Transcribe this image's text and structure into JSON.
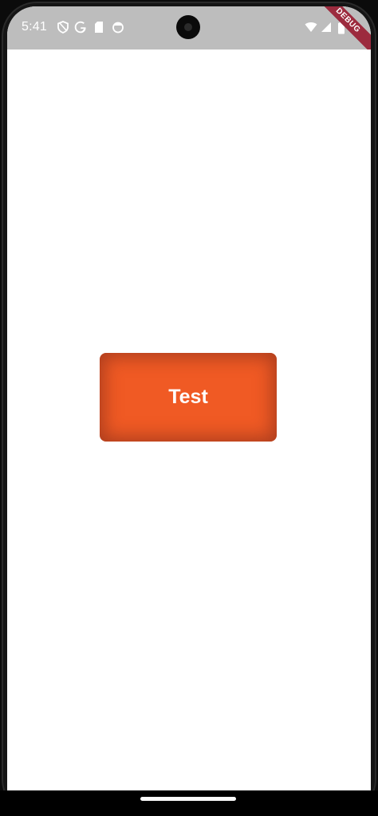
{
  "status_bar": {
    "time": "5:41",
    "left_icons": [
      "shield-icon",
      "google-icon",
      "sim-card-icon",
      "face-icon"
    ],
    "right_icons": [
      "wifi-icon",
      "signal-icon",
      "battery-icon"
    ],
    "background": "#bdbdbd"
  },
  "debug_banner": {
    "label": "DEBUG",
    "color": "#9c2b3e"
  },
  "main": {
    "button_label": "Test",
    "button_color": "#f05a24"
  }
}
